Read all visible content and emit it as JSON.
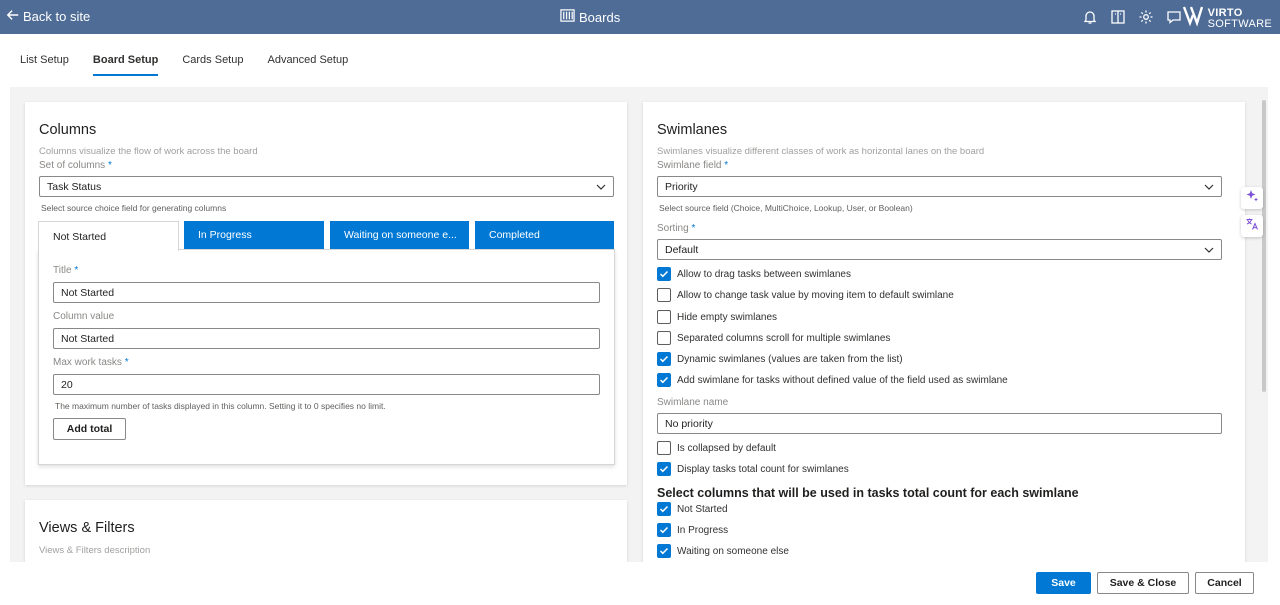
{
  "topbar": {
    "back_label": "Back to site",
    "app_title": "Boards",
    "logo_line1": "VIRTO",
    "logo_line2": "SOFTWARE",
    "icons": [
      "bell-icon",
      "book-icon",
      "gear-icon",
      "chat-icon"
    ]
  },
  "tabs": [
    {
      "label": "List Setup",
      "active": false
    },
    {
      "label": "Board Setup",
      "active": true
    },
    {
      "label": "Cards Setup",
      "active": false
    },
    {
      "label": "Advanced Setup",
      "active": false
    }
  ],
  "columns": {
    "title": "Columns",
    "description": "Columns visualize the flow of work across the board",
    "set_label": "Set of columns",
    "required_mark": "*",
    "set_value": "Task Status",
    "set_hint": "Select source choice field for generating columns",
    "column_tabs": [
      {
        "label": "Not Started",
        "active": true
      },
      {
        "label": "In Progress",
        "active": false
      },
      {
        "label": "Waiting on someone e...",
        "active": false
      },
      {
        "label": "Completed",
        "active": false
      }
    ],
    "title_label": "Title",
    "title_value": "Not Started",
    "column_value_label": "Column value",
    "column_value": "Not Started",
    "max_label": "Max work tasks",
    "max_value": "20",
    "max_hint": "The maximum number of tasks displayed in this column. Setting it to 0 specifies no limit.",
    "add_total_label": "Add total"
  },
  "views": {
    "title": "Views & Filters",
    "description": "Views & Filters description"
  },
  "swimlanes": {
    "title": "Swimlanes",
    "description": "Swimlanes visualize different classes of work as horizontal lanes on the board",
    "field_label": "Swimlane field",
    "field_value": "Priority",
    "field_hint": "Select source field (Choice, MultiChoice, Lookup, User, or Boolean)",
    "sorting_label": "Sorting",
    "sorting_value": "Default",
    "options": [
      {
        "label": "Allow to drag tasks between swimlanes",
        "checked": true
      },
      {
        "label": "Allow to change task value by moving item to default swimlane",
        "checked": false
      },
      {
        "label": "Hide empty swimlanes",
        "checked": false
      },
      {
        "label": "Separated columns scroll for multiple swimlanes",
        "checked": false
      },
      {
        "label": "Dynamic swimlanes (values are taken from the list)",
        "checked": true
      },
      {
        "label": "Add swimlane for tasks without defined value of the field used as swimlane",
        "checked": true
      }
    ],
    "name_label": "Swimlane name",
    "name_value": "No priority",
    "options2": [
      {
        "label": "Is collapsed by default",
        "checked": false
      },
      {
        "label": "Display tasks total count for swimlanes",
        "checked": true
      }
    ],
    "count_heading": "Select columns that will be used in tasks total count for each swimlane",
    "count_columns": [
      {
        "label": "Not Started",
        "checked": true
      },
      {
        "label": "In Progress",
        "checked": true
      },
      {
        "label": "Waiting on someone else",
        "checked": true
      }
    ]
  },
  "footer": {
    "save_label": "Save",
    "save_close_label": "Save & Close",
    "cancel_label": "Cancel"
  },
  "colors": {
    "topbar": "#4e6c96",
    "accent": "#0078d4",
    "fab_sparkle": "#7b4fd6"
  }
}
